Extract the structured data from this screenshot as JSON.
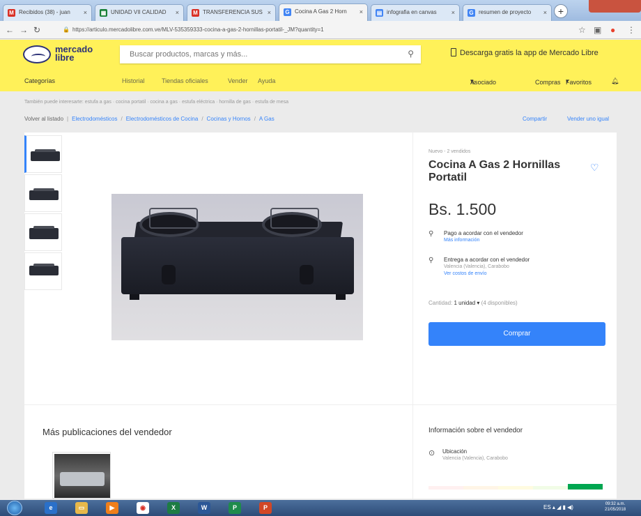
{
  "browser": {
    "tabs": [
      {
        "label": "Recibidos (38) - juan",
        "favicon": "gmail-icon",
        "color": "#d93025",
        "letter": "M"
      },
      {
        "label": "UNIDAD VII CALIDAD",
        "favicon": "sheets-icon",
        "color": "#188038",
        "letter": "▦"
      },
      {
        "label": "TRANSFERENCIA SUS",
        "favicon": "gmail-icon",
        "color": "#d93025",
        "letter": "M"
      },
      {
        "label": "Cocina A Gas 2 Horn",
        "favicon": "google-icon",
        "color": "#4285f4",
        "letter": "G"
      },
      {
        "label": "infografia en canvas",
        "favicon": "docs-icon",
        "color": "#4285f4",
        "letter": "▤"
      },
      {
        "label": "resumen de proyecto",
        "favicon": "google-icon",
        "color": "#4285f4",
        "letter": "G"
      }
    ],
    "url": "https://articulo.mercadolibre.com.ve/MLV-535359333-cocina-a-gas-2-hornillas-portatil-_JM?quantity=1"
  },
  "header": {
    "logo_line1": "mercado",
    "logo_line2": "libre",
    "search_placeholder": "Buscar productos, marcas y más...",
    "download_app": "Descarga gratis la app de Mercado Libre",
    "nav": {
      "categories": "Categorías",
      "history": "Historial",
      "official_stores": "Tiendas oficiales",
      "sell": "Vender",
      "help": "Ayuda",
      "user": "Asociado",
      "purchases": "Compras",
      "favorites": "Favoritos"
    }
  },
  "breadcrumbs": {
    "related": "También puede interesarte: estufa a gas · cocina portatil · cocina a gas · estufa eléctrica · hornilla de gas · estufa de mesa",
    "back": "Volver al listado",
    "items": [
      "Electrodomésticos",
      "Electrodomésticos de Cocina",
      "Cocinas y Hornos",
      "A Gas"
    ],
    "share": "Compartir",
    "sell_same": "Vender uno igual"
  },
  "product": {
    "condition": "Nuevo - 2 vendidos",
    "title": "Cocina A Gas 2 Hornillas Portatil",
    "price": "Bs. 1.500",
    "payment": "Pago a acordar con el vendedor",
    "payment_link": "Más información",
    "delivery": "Entrega a acordar con el vendedor",
    "delivery_location": "Valencia (Valencia), Carabobo",
    "delivery_link": "Ver costos de envío",
    "quantity_label": "Cantidad:",
    "quantity_value": "1 unidad",
    "stock": "(4 disponibles)",
    "buy_button": "Comprar"
  },
  "more_from_seller": {
    "title": "Más publicaciones del vendedor"
  },
  "seller": {
    "title": "Información sobre el vendedor",
    "location_label": "Ubicación",
    "location_value": "Valencia (Valencia), Carabobo",
    "reputation_colors": [
      "#fff0f0",
      "#fff5e6",
      "#fffbe0",
      "#f1fce6",
      "#00a650"
    ]
  },
  "taskbar": {
    "tray": "ES",
    "time": "09:32 a.m.",
    "date": "21/05/2018"
  }
}
